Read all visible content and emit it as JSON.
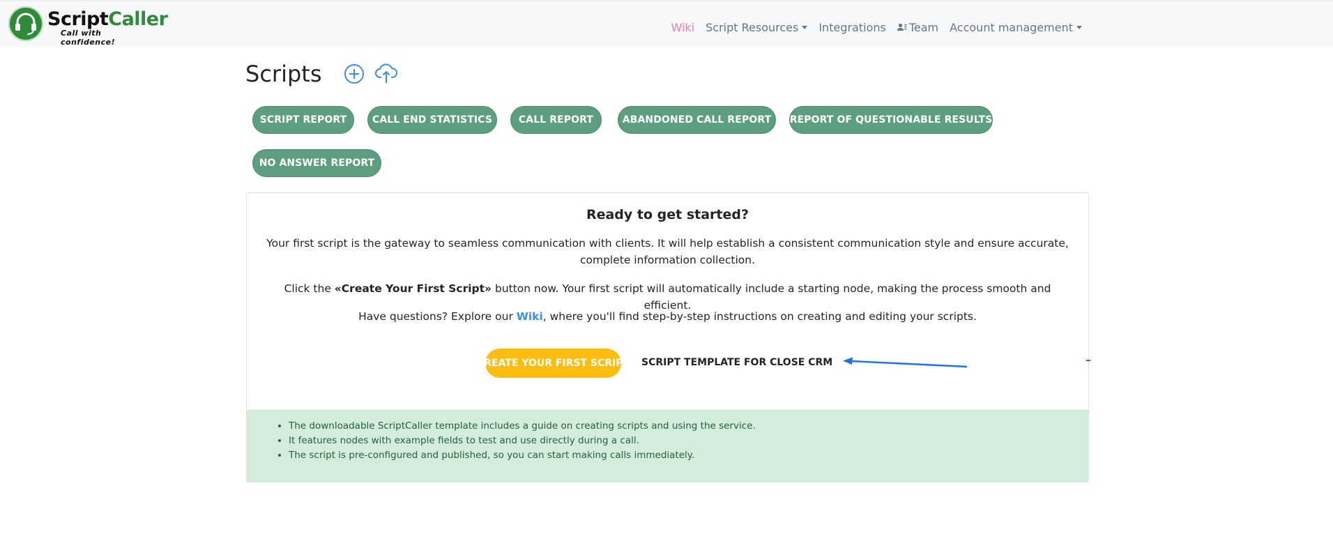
{
  "brand": {
    "name_part1": "Script",
    "name_part2": "Caller",
    "tagline": "Call with confidence!",
    "green": "#2f8a3a"
  },
  "nav": {
    "wiki": "Wiki",
    "script_resources": "Script Resources",
    "integrations": "Integrations",
    "team": "Team",
    "account_management": "Account management"
  },
  "page": {
    "title": "Scripts",
    "add_icon": "plus-circle-icon",
    "upload_icon": "cloud-upload-icon"
  },
  "reports": [
    "SCRIPT REPORT",
    "CALL END STATISTICS",
    "CALL REPORT",
    "ABANDONED CALL REPORT",
    "REPORT OF QUESTIONABLE RESULTS",
    "NO ANSWER REPORT"
  ],
  "card": {
    "title": "Ready to get started?",
    "p1": "Your first script is the gateway to seamless communication with clients. It will help establish a consistent communication style and ensure accurate, complete information collection.",
    "p2_before": "Click the ",
    "p2_bold": "«Create Your First Script»",
    "p2_after": " button now. Your first script will automatically include a starting node, making the process smooth and efficient.",
    "p3_before": "Have questions? Explore our ",
    "p3_link": "Wiki",
    "p3_after": ", where you'll find step-by-step instructions on creating and editing your scripts.",
    "create_button": "CREATE YOUR FIRST SCRIPT",
    "template_link": "SCRIPT TEMPLATE FOR CLOSE CRM",
    "info_items": [
      "The downloadable ScriptCaller template includes a guide on creating scripts and using the service.",
      "It features nodes with example fields to test and use directly during a call.",
      "The script is pre-configured and published, so you can start making calls immediately."
    ]
  },
  "colors": {
    "report_button": "#5e9e80",
    "create_button": "#fdbd10",
    "wiki_active": "#e083a6",
    "link_blue": "#3b8ee5",
    "info_bg": "#d4ecdb",
    "arrow": "#1a73e8"
  }
}
